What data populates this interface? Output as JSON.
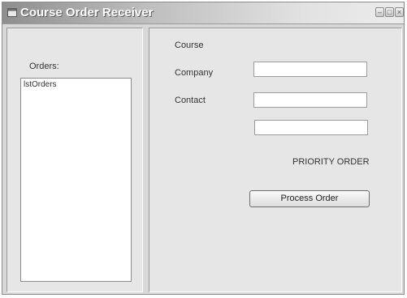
{
  "window": {
    "title": "Course Order Receiver",
    "controls": [
      "minimize-icon",
      "maximize-icon",
      "close-icon"
    ]
  },
  "left_panel": {
    "orders_label": "Orders:",
    "listbox_items": [
      "lstOrders"
    ]
  },
  "form": {
    "course_label": "Course",
    "course_value": "",
    "company_label": "Company",
    "company_value": "",
    "contact_label": "Contact",
    "contact_value": "",
    "priority_label": "PRIORITY ORDER",
    "process_button": "Process Order"
  }
}
